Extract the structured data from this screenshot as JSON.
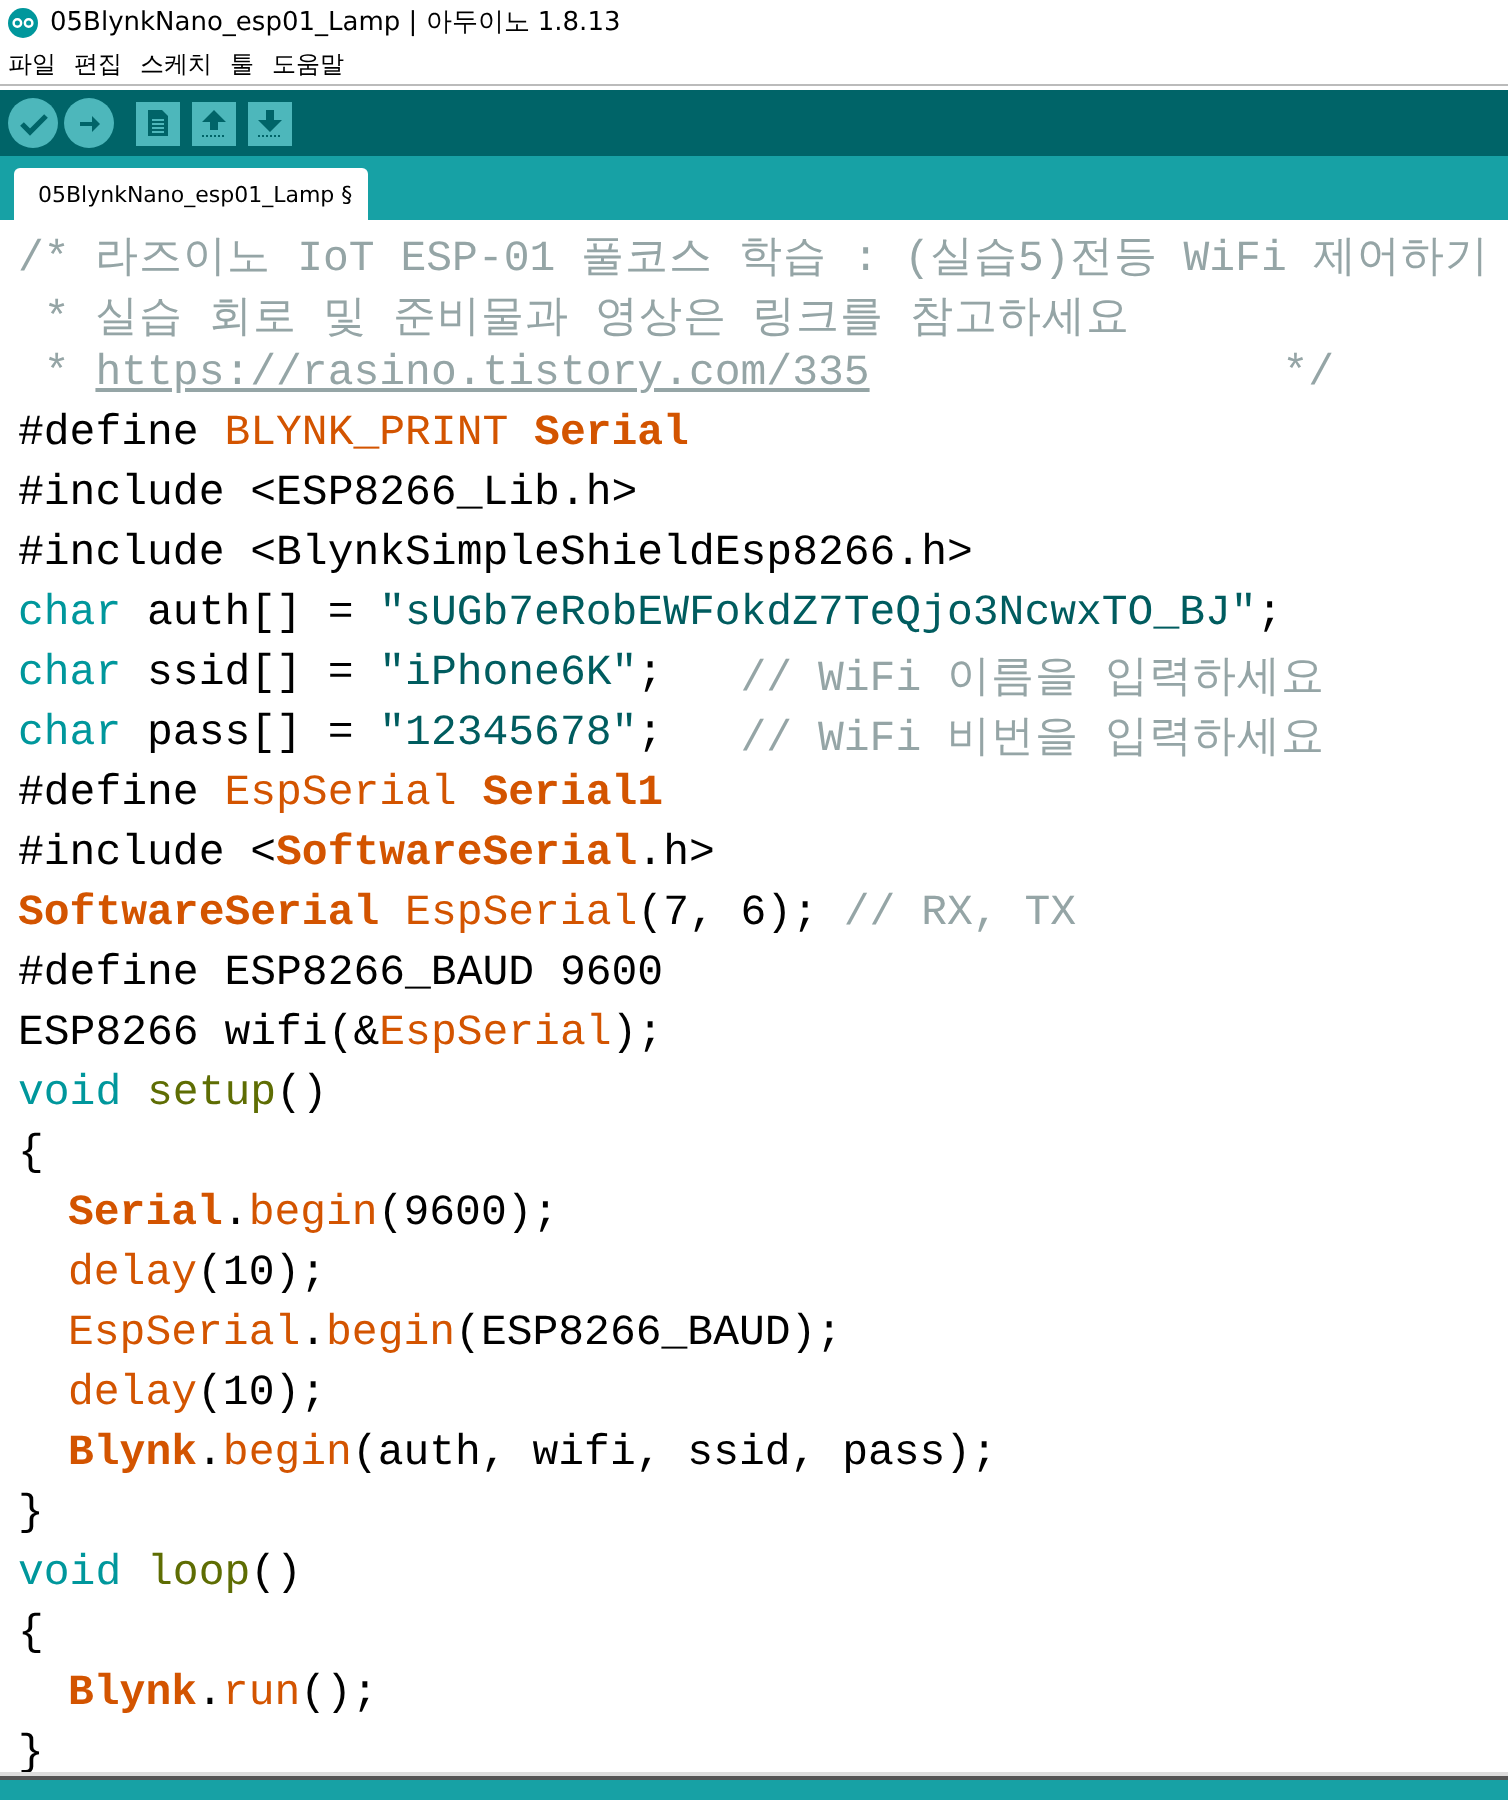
{
  "window": {
    "title": "05BlynkNano_esp01_Lamp | 아두이노 1.8.13"
  },
  "menu": [
    "파일",
    "편집",
    "스케치",
    "툴",
    "도움말"
  ],
  "toolbar": [
    {
      "kind": "verify"
    },
    {
      "kind": "upload"
    },
    {
      "kind": "new"
    },
    {
      "kind": "open"
    },
    {
      "kind": "save"
    }
  ],
  "tabs": [
    {
      "label": "05BlynkNano_esp01_Lamp §",
      "selected": true
    }
  ],
  "code": [
    {
      "indent": false,
      "tokens": [
        {
          "kind": "comment",
          "text": "/* 라즈이노 IoT ESP-01 풀코스 학습 : (실습5)전등 WiFi 제어하기"
        }
      ]
    },
    {
      "indent": false,
      "tokens": [
        {
          "kind": "comment",
          "text": " * 실습 회로 및 준비물과 영상은 링크를 참고하세요"
        }
      ]
    },
    {
      "indent": false,
      "tokens": [
        {
          "kind": "comment",
          "text": " * "
        },
        {
          "kind": "link",
          "text": "https://rasino.tistory.com/335"
        },
        {
          "kind": "comment",
          "text": "                */"
        }
      ]
    },
    {
      "indent": false,
      "tokens": [
        {
          "kind": "plain",
          "text": "#define "
        },
        {
          "kind": "fn",
          "text": "BLYNK_PRINT "
        },
        {
          "kind": "cls",
          "text": "Serial"
        }
      ]
    },
    {
      "indent": false,
      "tokens": [
        {
          "kind": "plain",
          "text": "#include <ESP8266_Lib.h>"
        }
      ]
    },
    {
      "indent": false,
      "tokens": [
        {
          "kind": "plain",
          "text": "#include <BlynkSimpleShieldEsp8266.h>"
        }
      ]
    },
    {
      "indent": false,
      "tokens": [
        {
          "kind": "kw",
          "text": "char"
        },
        {
          "kind": "plain",
          "text": " auth[] = "
        },
        {
          "kind": "str",
          "text": "\"sUGb7eRobEWFokdZ7TeQjo3NcwxTO_BJ\""
        },
        {
          "kind": "plain",
          "text": ";"
        }
      ]
    },
    {
      "indent": false,
      "tokens": [
        {
          "kind": "kw",
          "text": "char"
        },
        {
          "kind": "plain",
          "text": " ssid[] = "
        },
        {
          "kind": "str",
          "text": "\"iPhone6K\""
        },
        {
          "kind": "plain",
          "text": ";   "
        },
        {
          "kind": "comment",
          "text": "// WiFi 이름을 입력하세요"
        }
      ]
    },
    {
      "indent": false,
      "tokens": [
        {
          "kind": "kw",
          "text": "char"
        },
        {
          "kind": "plain",
          "text": " pass[] = "
        },
        {
          "kind": "str",
          "text": "\"12345678\""
        },
        {
          "kind": "plain",
          "text": ";   "
        },
        {
          "kind": "comment",
          "text": "// WiFi 비번을 입력하세요"
        }
      ]
    },
    {
      "indent": false,
      "tokens": [
        {
          "kind": "plain",
          "text": "#define "
        },
        {
          "kind": "fn",
          "text": "EspSerial "
        },
        {
          "kind": "cls",
          "text": "Serial1"
        }
      ]
    },
    {
      "indent": false,
      "tokens": [
        {
          "kind": "plain",
          "text": "#include <"
        },
        {
          "kind": "cls",
          "text": "SoftwareSerial"
        },
        {
          "kind": "plain",
          "text": ".h>"
        }
      ]
    },
    {
      "indent": false,
      "tokens": [
        {
          "kind": "cls",
          "text": "SoftwareSerial "
        },
        {
          "kind": "fn",
          "text": "EspSerial"
        },
        {
          "kind": "plain",
          "text": "(7, 6); "
        },
        {
          "kind": "comment",
          "text": "// RX, TX"
        }
      ]
    },
    {
      "indent": false,
      "tokens": [
        {
          "kind": "plain",
          "text": "#define ESP8266_BAUD 9600"
        }
      ]
    },
    {
      "indent": false,
      "tokens": [
        {
          "kind": "plain",
          "text": "ESP8266 wifi(&"
        },
        {
          "kind": "fn",
          "text": "EspSerial"
        },
        {
          "kind": "plain",
          "text": ");"
        }
      ]
    },
    {
      "indent": false,
      "tokens": [
        {
          "kind": "kw",
          "text": "void "
        },
        {
          "kind": "olive",
          "text": "setup"
        },
        {
          "kind": "plain",
          "text": "()"
        }
      ]
    },
    {
      "indent": false,
      "tokens": [
        {
          "kind": "plain",
          "text": "{"
        }
      ]
    },
    {
      "indent": true,
      "tokens": [
        {
          "kind": "cls",
          "text": "Serial"
        },
        {
          "kind": "plain",
          "text": "."
        },
        {
          "kind": "fn",
          "text": "begin"
        },
        {
          "kind": "plain",
          "text": "(9600);"
        }
      ]
    },
    {
      "indent": true,
      "tokens": [
        {
          "kind": "fn",
          "text": "delay"
        },
        {
          "kind": "plain",
          "text": "(10);"
        }
      ]
    },
    {
      "indent": true,
      "tokens": [
        {
          "kind": "fn",
          "text": "EspSerial"
        },
        {
          "kind": "plain",
          "text": "."
        },
        {
          "kind": "fn",
          "text": "begin"
        },
        {
          "kind": "plain",
          "text": "(ESP8266_BAUD);"
        }
      ]
    },
    {
      "indent": true,
      "tokens": [
        {
          "kind": "fn",
          "text": "delay"
        },
        {
          "kind": "plain",
          "text": "(10);"
        }
      ]
    },
    {
      "indent": true,
      "tokens": [
        {
          "kind": "cls",
          "text": "Blynk"
        },
        {
          "kind": "plain",
          "text": "."
        },
        {
          "kind": "fn",
          "text": "begin"
        },
        {
          "kind": "plain",
          "text": "(auth, wifi, ssid, pass);"
        }
      ]
    },
    {
      "indent": false,
      "tokens": [
        {
          "kind": "plain",
          "text": "}"
        }
      ]
    },
    {
      "indent": false,
      "tokens": [
        {
          "kind": "kw",
          "text": "void "
        },
        {
          "kind": "olive",
          "text": "loop"
        },
        {
          "kind": "plain",
          "text": "()"
        }
      ]
    },
    {
      "indent": false,
      "tokens": [
        {
          "kind": "plain",
          "text": "{"
        }
      ]
    },
    {
      "indent": true,
      "tokens": [
        {
          "kind": "cls",
          "text": "Blynk"
        },
        {
          "kind": "plain",
          "text": "."
        },
        {
          "kind": "fn",
          "text": "run"
        },
        {
          "kind": "plain",
          "text": "();"
        }
      ]
    },
    {
      "indent": false,
      "tokens": [
        {
          "kind": "plain",
          "text": "}"
        }
      ]
    }
  ]
}
